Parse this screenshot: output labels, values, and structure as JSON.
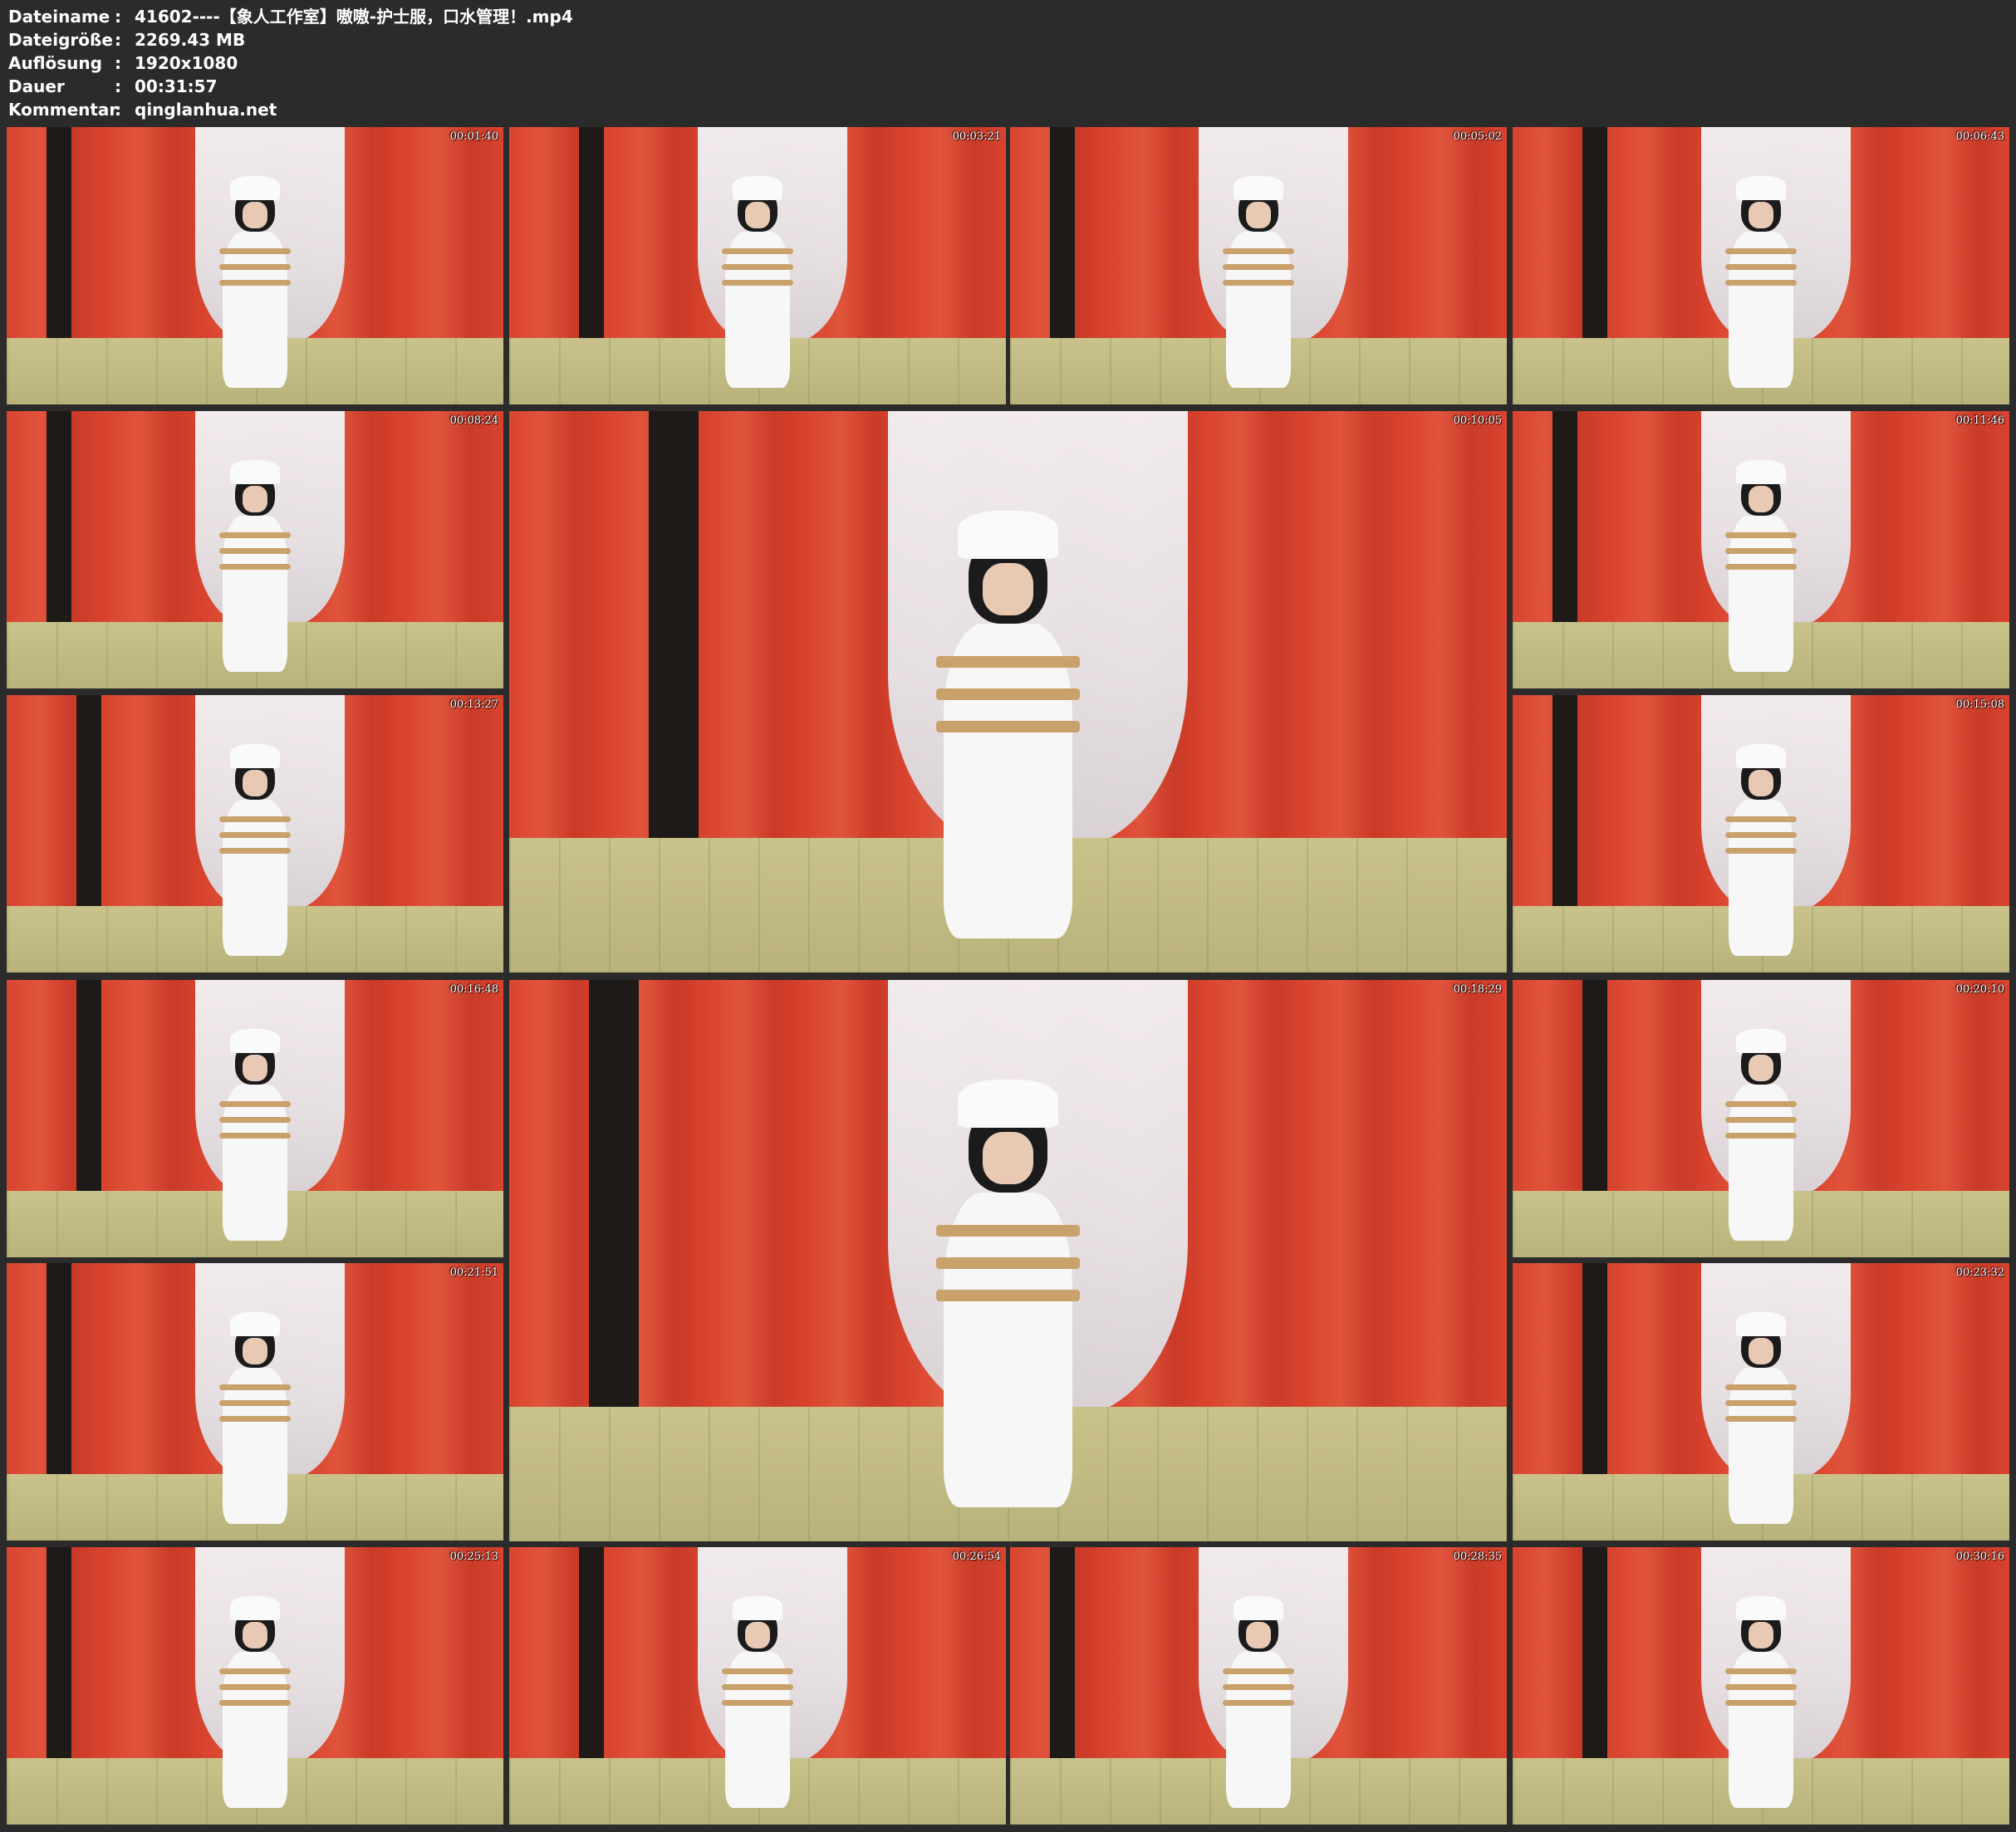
{
  "meta": {
    "filename_key": "Dateiname",
    "filename_value": "41602----【象人工作室】嗷嗷-护士服，口水管理！.mp4",
    "filesize_key": "Dateigröße",
    "filesize_value": "2269.43 MB",
    "resolution_key": "Auflösung",
    "resolution_value": "1920x1080",
    "duration_key": "Dauer",
    "duration_value": "00:31:57",
    "comment_key": "Kommentar",
    "comment_value": "qinglanhua.net",
    "separator": ":"
  },
  "thumbnails": [
    {
      "time": "00:01:40"
    },
    {
      "time": "00:03:21"
    },
    {
      "time": "00:05:02"
    },
    {
      "time": "00:06:43"
    },
    {
      "time": "00:08:24"
    },
    {
      "time": "00:10:05"
    },
    {
      "time": "00:11:46"
    },
    {
      "time": "00:13:27"
    },
    {
      "time": "00:15:08"
    },
    {
      "time": "00:16:48"
    },
    {
      "time": "00:18:29"
    },
    {
      "time": "00:20:10"
    },
    {
      "time": "00:21:51"
    },
    {
      "time": "00:23:32"
    },
    {
      "time": "00:25:13"
    },
    {
      "time": "00:26:54"
    },
    {
      "time": "00:28:35"
    },
    {
      "time": "00:30:16"
    }
  ]
}
